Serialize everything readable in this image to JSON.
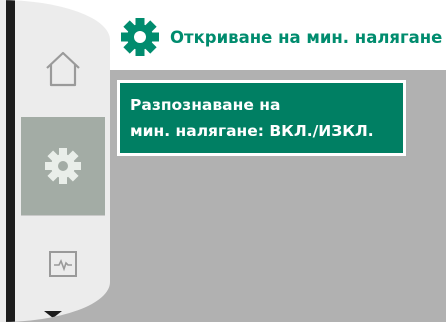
{
  "header": {
    "title": "Откриване на мин. налягане",
    "icon": "gear-icon",
    "accent_color": "#008c6e"
  },
  "sidebar": {
    "items": [
      {
        "name": "home",
        "icon": "home-icon",
        "selected": false
      },
      {
        "name": "settings",
        "icon": "gear-icon",
        "selected": true
      },
      {
        "name": "diagnostics",
        "icon": "pulse-monitor-icon",
        "selected": false
      }
    ],
    "more_indicator": "chevron-down-icon"
  },
  "menu": {
    "items": [
      {
        "line1": "Разпознаване на",
        "line2": "мин. налягане: ВКЛ./ИЗКЛ.",
        "selected": true
      }
    ],
    "highlight_color": "#007f63"
  }
}
